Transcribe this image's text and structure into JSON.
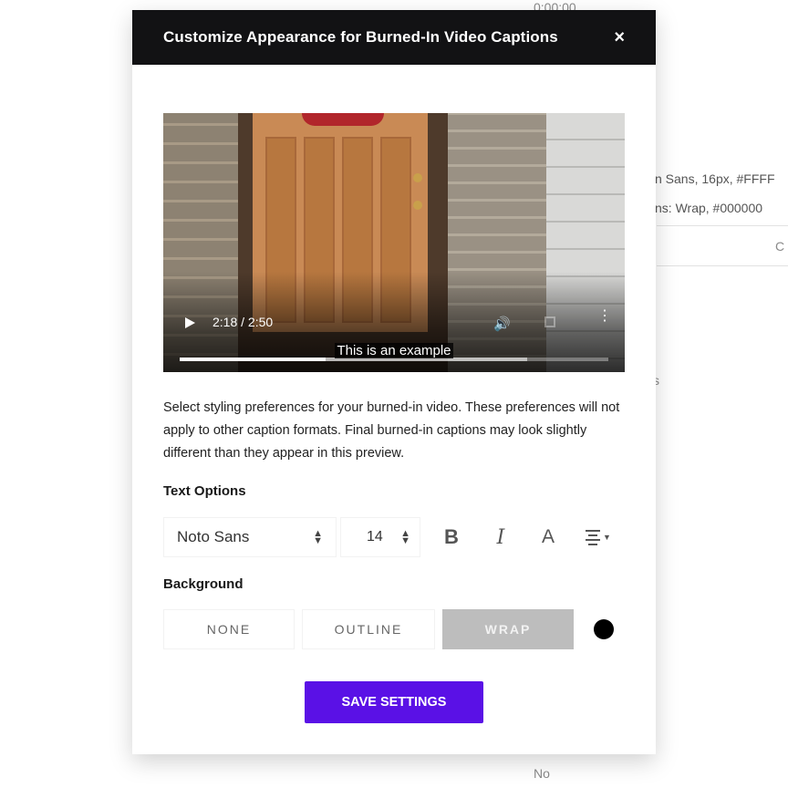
{
  "background_page": {
    "top_time": "0:00:00",
    "line1": "n Sans, 16px, #FFFF",
    "line2": "ns: Wrap, #000000",
    "column_header": "C",
    "dot": "s",
    "bottom_text": "No"
  },
  "modal": {
    "title": "Customize Appearance for Burned-In Video Captions",
    "close_icon": "×"
  },
  "video": {
    "time": "2:18 / 2:50",
    "caption": "This is an example",
    "progress": 0.34,
    "buffered": 0.81
  },
  "description": "Select styling preferences for your burned-in video. These preferences will not apply to other caption formats. Final burned-in captions may look slightly different than they appear in this preview.",
  "text_options": {
    "label": "Text Options",
    "font": "Noto Sans",
    "size": "14",
    "bold": "B",
    "italic": "I",
    "color": "A"
  },
  "background": {
    "label": "Background",
    "options": [
      "NONE",
      "OUTLINE",
      "WRAP"
    ],
    "selected": "WRAP",
    "color": "#000000"
  },
  "save_label": "SAVE SETTINGS"
}
